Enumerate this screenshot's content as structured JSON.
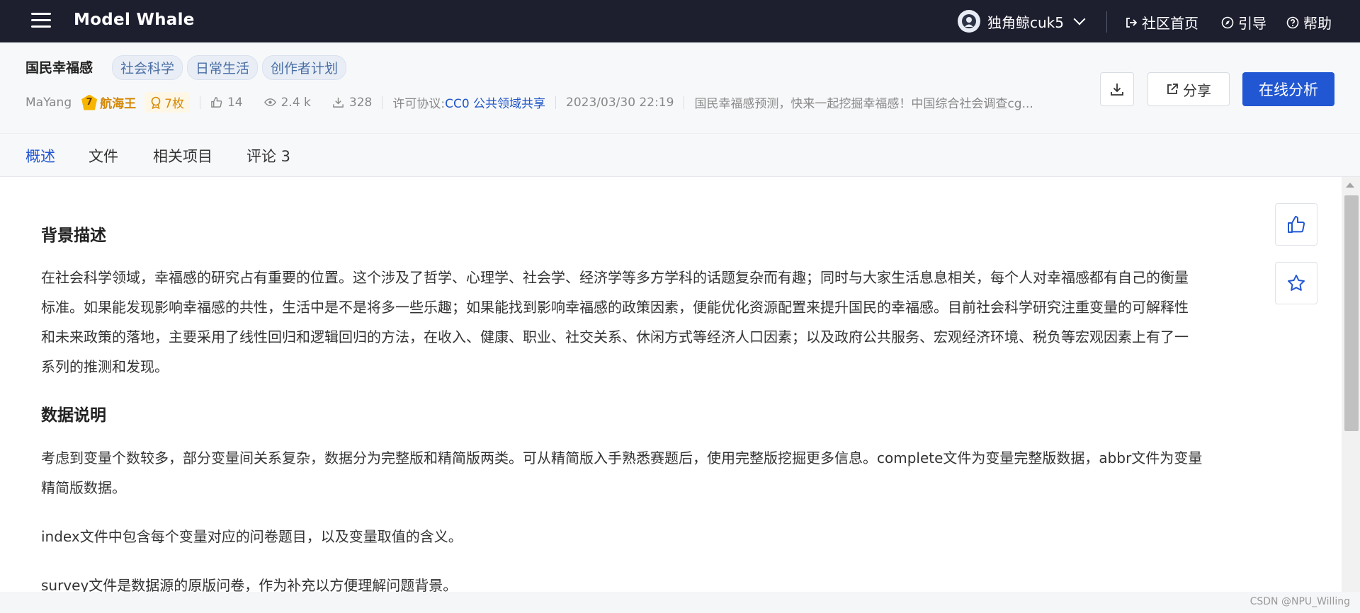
{
  "topbar": {
    "brand": "Model Whale",
    "username": "独角鲸cuk5",
    "links": {
      "community": "社区首页",
      "guide": "引导",
      "help": "帮助"
    }
  },
  "dataset": {
    "title": "国民幸福感",
    "tags": [
      "社会科学",
      "日常生活",
      "创作者计划"
    ],
    "author": "MaYang",
    "level_num": "7",
    "level_title": "航海王",
    "medals": "7枚",
    "likes": "14",
    "views": "2.4 k",
    "downloads": "328",
    "license_label": "许可协议:",
    "license": "CC0 公共领域共享",
    "date": "2023/03/30 22:19",
    "summary": "国民幸福感预测，快来一起挖掘幸福感！中国综合社会调查cg..."
  },
  "actions": {
    "share": "分享",
    "analyze": "在线分析"
  },
  "tabs": [
    "概述",
    "文件",
    "相关项目",
    "评论 3"
  ],
  "article": {
    "h1": "背景描述",
    "p1_lines": [
      "在社会科学领域，幸福感的研究占有重要的位置。这个涉及了哲学、心理学、社会学、经济学等多方学科的话题复杂而有趣；同时与大家生活息息相关，每个人对幸福感都有自己的衡量",
      "标准。如果能发现影响幸福感的共性，生活中是不是将多一些乐趣；如果能找到影响幸福感的政策因素，便能优化资源配置来提升国民的幸福感。目前社会科学研究注重变量的可解释性",
      "和未来政策的落地，主要采用了线性回归和逻辑回归的方法，在收入、健康、职业、社交关系、休闲方式等经济人口因素；以及政府公共服务、宏观经济环境、税负等宏观因素上有了一",
      "系列的推测和发现。"
    ],
    "h2": "数据说明",
    "p2_lines": [
      "考虑到变量个数较多，部分变量间关系复杂，数据分为完整版和精简版两类。可从精简版入手熟悉赛题后，使用完整版挖掘更多信息。complete文件为变量完整版数据，abbr文件为变量",
      "精简版数据。"
    ],
    "p3": "index文件中包含每个变量对应的问卷题目，以及变量取值的含义。",
    "p4": "survey文件是数据源的原版问卷，作为补充以方便理解问题背景。"
  },
  "watermark": "CSDN @NPU_Willing",
  "colors": {
    "primary": "#2157d2",
    "topbar": "#1d1f2f",
    "gold": "#d48806"
  }
}
